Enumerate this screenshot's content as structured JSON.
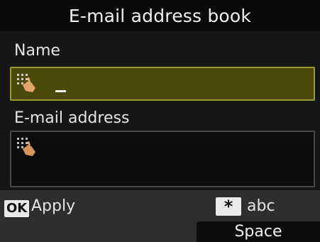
{
  "header": {
    "title": "E-mail address book"
  },
  "form": {
    "name_label": "Name",
    "email_label": "E-mail address"
  },
  "footer": {
    "ok_key": "OK",
    "apply_label": "Apply",
    "star_key": "*",
    "input_mode_label": "abc",
    "space_label": "Space"
  },
  "colors": {
    "background": "#141414",
    "selected_field": "#4b4a0a",
    "footer": "#2e2e2e"
  },
  "icons": {
    "field_icon": "touch-keypad-hand-icon"
  }
}
